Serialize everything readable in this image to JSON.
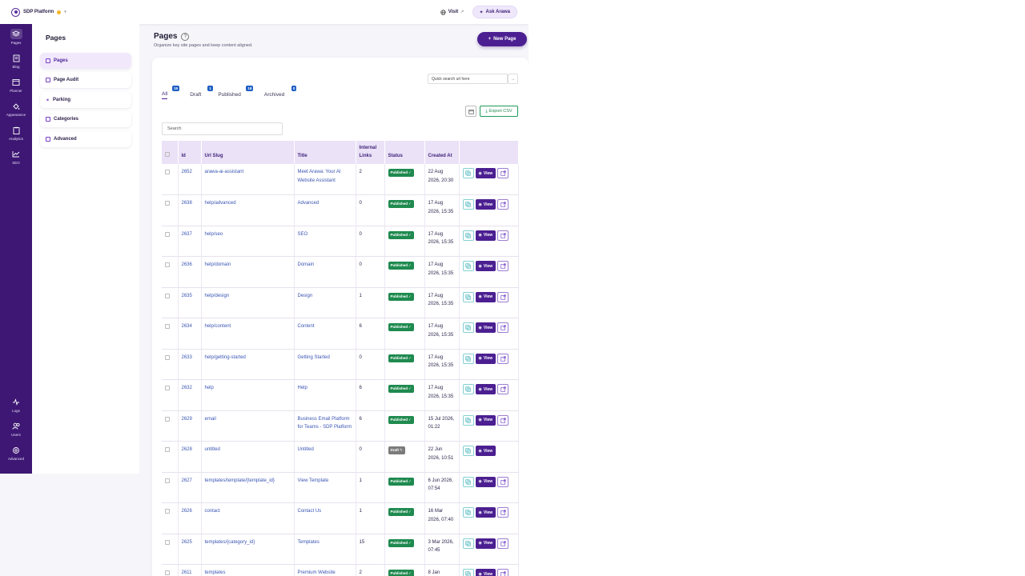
{
  "topbar": {
    "brand": "SDP Platform",
    "visit": "Visit",
    "ask": "Ask Arawa"
  },
  "sidebar": {
    "top": [
      {
        "key": "pages",
        "label": "Pages",
        "active": true
      },
      {
        "key": "blog",
        "label": "Blog"
      },
      {
        "key": "planner",
        "label": "Planner"
      },
      {
        "key": "appearance",
        "label": "Appearance"
      },
      {
        "key": "analytics",
        "label": "Analytics"
      },
      {
        "key": "seo",
        "label": "SEO"
      }
    ],
    "bottom": [
      {
        "key": "logs",
        "label": "Logs"
      },
      {
        "key": "users",
        "label": "Users"
      },
      {
        "key": "advanced",
        "label": "Advanced"
      }
    ]
  },
  "subnav": {
    "title": "Pages",
    "items": [
      {
        "label": "Pages",
        "active": true
      },
      {
        "label": "Page Audit"
      },
      {
        "label": "Parking"
      },
      {
        "label": "Categories"
      },
      {
        "label": "Advanced"
      }
    ]
  },
  "main": {
    "title": "Pages",
    "subtitle": "Organize key site pages and keep content aligned.",
    "new_button": "New Page",
    "quick_search_placeholder": "Quick search url here",
    "tabs": [
      {
        "label": "All",
        "count": "19",
        "active": true
      },
      {
        "label": "Draft",
        "count": "1"
      },
      {
        "label": "Published",
        "count": "18"
      },
      {
        "label": "Archived",
        "count": "0"
      }
    ],
    "export_label": "Export CSV",
    "search_placeholder": "Search"
  },
  "table": {
    "headers": [
      "Id",
      "Url Slug",
      "Title",
      "Internal Links",
      "Status",
      "Created At"
    ],
    "view_label": "View",
    "rows": [
      {
        "id": "2652",
        "slug": "arawa-ai-assistant",
        "title": "Meet Arawa: Your AI Website Assistant",
        "links": "2",
        "status": "Published",
        "created": "22 Aug 2026, 20:30"
      },
      {
        "id": "2638",
        "slug": "help/advanced",
        "title": "Advanced",
        "links": "0",
        "status": "Published",
        "created": "17 Aug 2026, 15:35"
      },
      {
        "id": "2637",
        "slug": "help/seo",
        "title": "SEO",
        "links": "0",
        "status": "Published",
        "created": "17 Aug 2026, 15:35"
      },
      {
        "id": "2636",
        "slug": "help/domain",
        "title": "Domain",
        "links": "0",
        "status": "Published",
        "created": "17 Aug 2026, 15:35"
      },
      {
        "id": "2635",
        "slug": "help/design",
        "title": "Design",
        "links": "1",
        "status": "Published",
        "created": "17 Aug 2026, 15:35"
      },
      {
        "id": "2634",
        "slug": "help/content",
        "title": "Content",
        "links": "6",
        "status": "Published",
        "created": "17 Aug 2026, 15:35"
      },
      {
        "id": "2633",
        "slug": "help/getting-started",
        "title": "Getting Started",
        "links": "0",
        "status": "Published",
        "created": "17 Aug 2026, 15:35"
      },
      {
        "id": "2632",
        "slug": "help",
        "title": "Help",
        "links": "6",
        "status": "Published",
        "created": "17 Aug 2026, 15:35"
      },
      {
        "id": "2629",
        "slug": "email",
        "title": "Business Email Platform for Teams - SDP Platform",
        "links": "6",
        "status": "Published",
        "created": "15 Jul 2026, 01:22"
      },
      {
        "id": "2628",
        "slug": "untitled",
        "title": "Untitled",
        "links": "0",
        "status": "Draft",
        "created": "22 Jun 2026, 10:51"
      },
      {
        "id": "2627",
        "slug": "templates/template/{template_id}",
        "title": "View Template",
        "links": "1",
        "status": "Published",
        "created": "6 Jun 2026, 07:54"
      },
      {
        "id": "2626",
        "slug": "contact",
        "title": "Contact Us",
        "links": "1",
        "status": "Published",
        "created": "16 Mar 2026, 07:40"
      },
      {
        "id": "2625",
        "slug": "templates/{category_id}",
        "title": "Templates",
        "links": "15",
        "status": "Published",
        "created": "3 Mar 2026, 07:45"
      },
      {
        "id": "2611",
        "slug": "templates",
        "title": "Premium Website",
        "links": "2",
        "status": "Published",
        "created": "8 Jan"
      }
    ]
  }
}
